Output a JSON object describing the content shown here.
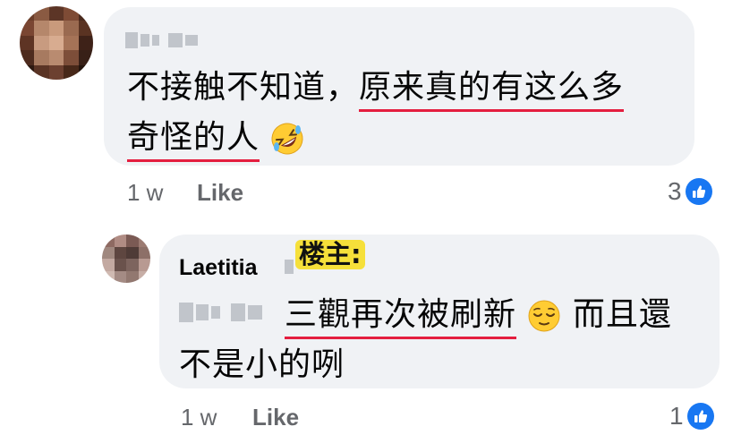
{
  "comments": [
    {
      "author": "",
      "line1_plain": "不接触不知道，",
      "line1_underlined": "原来真的有这么多",
      "line2_underlined": "奇怪的人",
      "emoji": "rolling-on-floor-laughing",
      "time": "1 w",
      "like_label": "Like",
      "reaction_count": "3"
    },
    {
      "author": "Laetitia",
      "op_badge": "楼主:",
      "line1_underlined": "三觀再次被刷新",
      "emoji": "relieved-face",
      "line1_tail": " 而且還",
      "line2_plain": "不是小的咧",
      "time": "1 w",
      "like_label": "Like",
      "reaction_count": "1"
    }
  ],
  "colors": {
    "bubble_bg": "#f0f2f5",
    "underline": "#e41e3f",
    "meta_text": "#65676b",
    "like_blue": "#1877f2",
    "badge_yellow": "#f6e03a"
  }
}
